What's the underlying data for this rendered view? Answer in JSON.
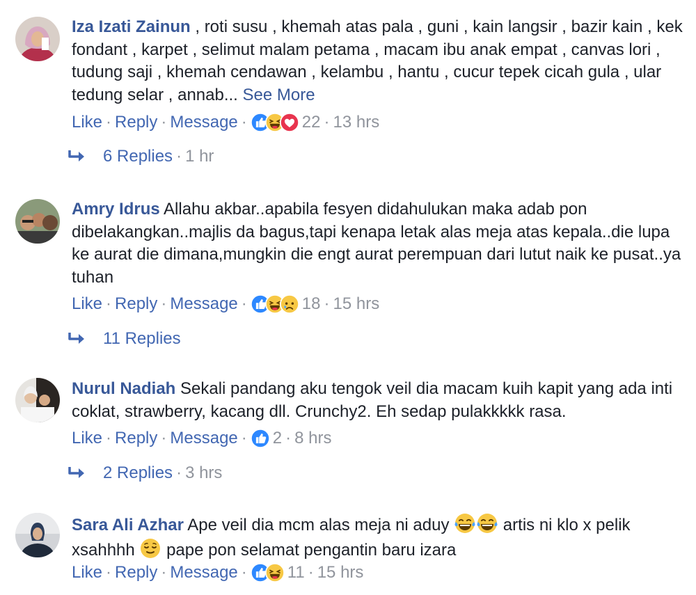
{
  "comments": [
    {
      "name": "Iza Izati Zainun",
      "text": " , roti susu , khemah atas pala , guni , kain langsir , bazir kain , kek fondant , karpet , selimut malam petama , macam ibu anak empat , canvas lori , tudung saji , khemah cendawan , kelambu , hantu , cucur tepek cicah gula , ular tedung selar , annab... ",
      "see_more": "See More",
      "like": "Like",
      "reply": "Reply",
      "message": "Message",
      "reactions": [
        "like-icon",
        "haha-icon",
        "love-icon"
      ],
      "count": "22",
      "time": "13 hrs",
      "replies_label": "6 Replies",
      "replies_time": "1 hr"
    },
    {
      "name": "Amry Idrus",
      "text": " Allahu akbar..apabila fesyen didahulukan maka adab pon dibelakangkan..majlis da bagus,tapi kenapa letak alas meja atas kepala..die lupa ke aurat die dimana,mungkin die engt aurat perempuan dari lutut naik ke pusat..ya tuhan",
      "like": "Like",
      "reply": "Reply",
      "message": "Message",
      "reactions": [
        "like-icon",
        "haha-icon",
        "sad-icon"
      ],
      "count": "18",
      "time": "15 hrs",
      "replies_label": "11 Replies"
    },
    {
      "name": "Nurul Nadiah",
      "text": " Sekali pandang aku tengok veil dia macam kuih kapit yang ada inti coklat, strawberry, kacang dll. Crunchy2. Eh sedap pulakkkkk rasa.",
      "like": "Like",
      "reply": "Reply",
      "message": "Message",
      "reactions": [
        "like-icon"
      ],
      "count": "2",
      "time": "8 hrs",
      "replies_label": "2 Replies",
      "replies_time": "3 hrs"
    },
    {
      "name": "Sara Ali Azhar",
      "text_a": " Ape veil dia mcm alas meja ni aduy ",
      "text_b": " artis ni klo x pelik xsahhhh ",
      "text_c": " pape pon selamat pengantin baru izara",
      "like": "Like",
      "reply": "Reply",
      "message": "Message",
      "reactions": [
        "like-icon",
        "haha-icon"
      ],
      "count": "11",
      "time": "15 hrs"
    }
  ],
  "colors": {
    "name": "#385898",
    "link": "#4267b2",
    "meta": "#90949c",
    "like_blue": "#2d88ff",
    "emoji_yellow": "#f7c844",
    "love_red": "#e8344e"
  }
}
